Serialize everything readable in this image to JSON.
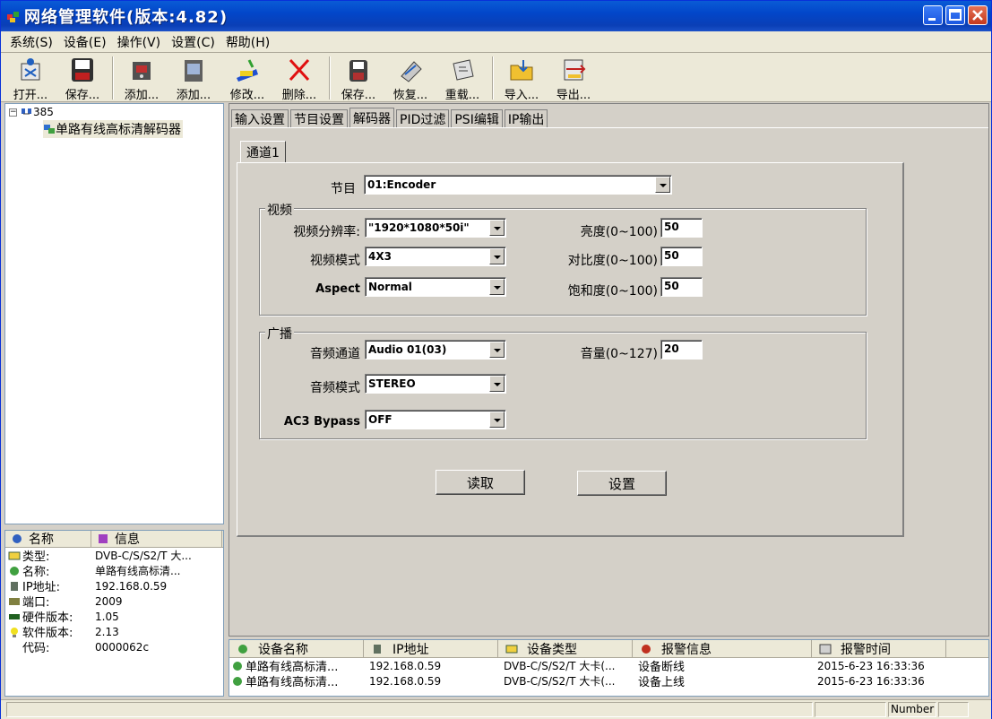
{
  "window": {
    "title": "网络管理软件(版本:4.82)"
  },
  "menu": [
    "系统(S)",
    "设备(E)",
    "操作(V)",
    "设置(C)",
    "帮助(H)"
  ],
  "toolbar": [
    {
      "label": "打开...",
      "icon": "open-icon"
    },
    {
      "label": "保存...",
      "icon": "save-icon"
    },
    {
      "label": "添加...",
      "icon": "add-device-icon"
    },
    {
      "label": "添加...",
      "icon": "add-card-icon"
    },
    {
      "label": "修改...",
      "icon": "edit-icon"
    },
    {
      "label": "删除...",
      "icon": "delete-icon"
    },
    {
      "label": "保存...",
      "icon": "save-config-icon"
    },
    {
      "label": "恢复...",
      "icon": "restore-icon"
    },
    {
      "label": "重载...",
      "icon": "reload-icon"
    },
    {
      "label": "导入...",
      "icon": "import-icon"
    },
    {
      "label": "导出...",
      "icon": "export-icon"
    }
  ],
  "tree": {
    "root": "385",
    "node": "单路有线高标清解码器"
  },
  "info": {
    "headers": [
      "名称",
      "信息"
    ],
    "rows": [
      {
        "key": "类型:",
        "value": "DVB-C/S/S2/T 大..."
      },
      {
        "key": "名称:",
        "value": "单路有线高标清..."
      },
      {
        "key": "IP地址:",
        "value": "192.168.0.59"
      },
      {
        "key": "端口:",
        "value": "2009"
      },
      {
        "key": "硬件版本:",
        "value": "1.05"
      },
      {
        "key": "软件版本:",
        "value": "2.13"
      },
      {
        "key": "代码:",
        "value": "0000062c"
      }
    ]
  },
  "tabs": [
    "输入设置",
    "节目设置",
    "解码器",
    "PID过滤",
    "PSI编辑",
    "IP输出"
  ],
  "subtab": "通道1",
  "form": {
    "program_label": "节目",
    "program_value": "01:Encoder",
    "video_group": "视频",
    "resolution_label": "视频分辨率:",
    "resolution_value": "\"1920*1080*50i\"",
    "video_mode_label": "视频模式",
    "video_mode_value": "4X3",
    "aspect_label": "Aspect",
    "aspect_value": "Normal",
    "brightness_label": "亮度(0~100)",
    "brightness_value": "50",
    "contrast_label": "对比度(0~100)",
    "contrast_value": "50",
    "saturation_label": "饱和度(0~100)",
    "saturation_value": "50",
    "audio_group": "广播",
    "audio_channel_label": "音频通道",
    "audio_channel_value": "Audio 01(03)",
    "volume_label": "音量(0~127)",
    "volume_value": "20",
    "audio_mode_label": "音频模式",
    "audio_mode_value": "STEREO",
    "ac3_label": "AC3 Bypass",
    "ac3_value": "OFF",
    "read_button": "读取",
    "set_button": "设置"
  },
  "alarm": {
    "headers": [
      "设备名称",
      "IP地址",
      "设备类型",
      "报警信息",
      "报警时间"
    ],
    "rows": [
      {
        "name": "单路有线高标清...",
        "ip": "192.168.0.59",
        "type": "DVB-C/S/S2/T 大卡(...",
        "msg": "设备断线",
        "time": "2015-6-23 16:33:36"
      },
      {
        "name": "单路有线高标清...",
        "ip": "192.168.0.59",
        "type": "DVB-C/S/S2/T 大卡(...",
        "msg": "设备上线",
        "time": "2015-6-23 16:33:36"
      }
    ]
  },
  "status": {
    "number": "Number"
  }
}
